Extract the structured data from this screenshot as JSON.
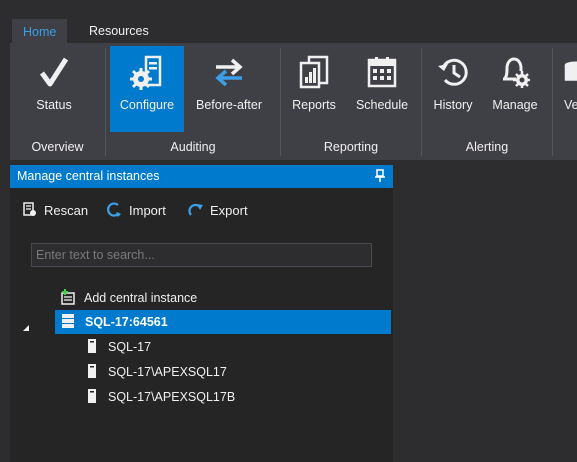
{
  "tabs": [
    {
      "label": "Home",
      "active": true
    },
    {
      "label": "Resources",
      "active": false
    }
  ],
  "ribbon": {
    "buttons": [
      {
        "label": "Status",
        "icon": "checkmark-icon"
      },
      {
        "label": "Configure",
        "icon": "server-config-icon",
        "selected": true
      },
      {
        "label": "Before-after",
        "icon": "swap-arrows-icon"
      },
      {
        "label": "Reports",
        "icon": "reports-icon"
      },
      {
        "label": "Schedule",
        "icon": "calendar-icon"
      },
      {
        "label": "History",
        "icon": "history-icon"
      },
      {
        "label": "Manage",
        "icon": "bell-gear-icon"
      },
      {
        "label": "Ve",
        "icon": "database-icon"
      }
    ],
    "groups": [
      "Overview",
      "Auditing",
      "Reporting",
      "Alerting"
    ]
  },
  "panel": {
    "title": "Manage central instances",
    "toolbar": {
      "rescan": "Rescan",
      "import": "Import",
      "export": "Export"
    },
    "search_placeholder": "Enter text to search...",
    "tree": {
      "add_label": "Add central instance",
      "root": "SQL-17:64561",
      "children": [
        "SQL-17",
        "SQL-17\\APEXSQL17",
        "SQL-17\\APEXSQL17B"
      ]
    }
  },
  "colors": {
    "accent": "#007acc",
    "background": "#2d2d30",
    "ribbon": "#3f3f46",
    "panel": "#252526",
    "active_tab_text": "#3d9ee8"
  }
}
